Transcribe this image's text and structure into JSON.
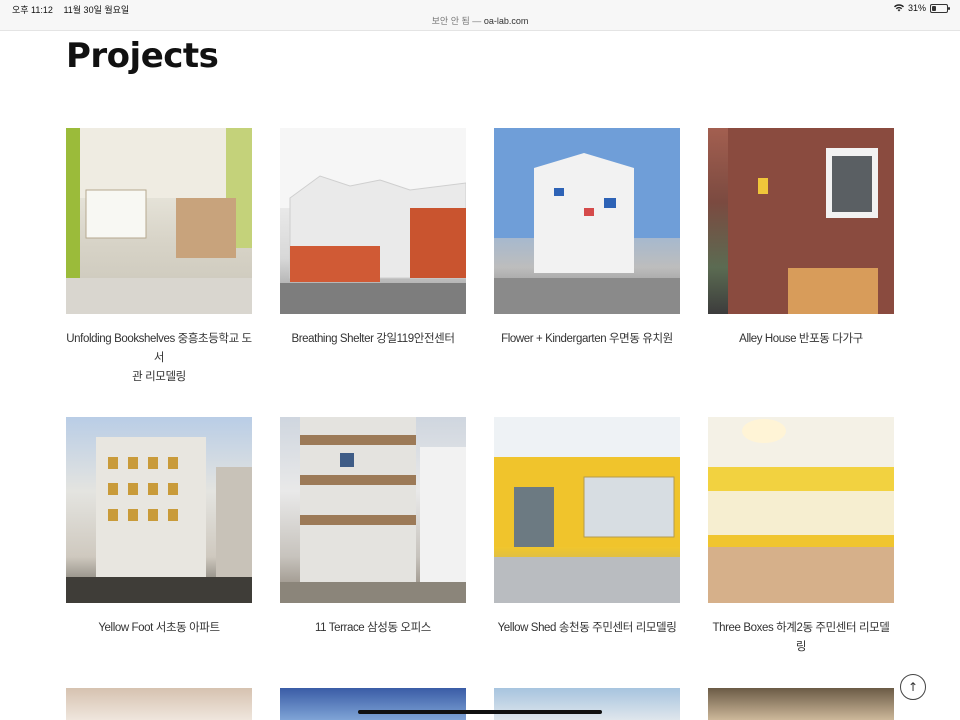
{
  "status": {
    "time": "오후 11:12",
    "date": "11월 30일 월요일",
    "battery": "31%",
    "battery_level": 0.31
  },
  "url": {
    "security": "보안 안 됨",
    "separator": "—",
    "host": "oa-lab.com"
  },
  "page": {
    "title": "Projects"
  },
  "projects": [
    {
      "line1": "Unfolding Bookshelves 중흥초등학교 도서",
      "line2": "관 리모델링"
    },
    {
      "line1": "Breathing Shelter 강일119안전센터",
      "line2": ""
    },
    {
      "line1": "Flower + Kindergarten 우면동 유치원",
      "line2": ""
    },
    {
      "line1": "Alley House 반포동 다가구",
      "line2": ""
    },
    {
      "line1": "Yellow Foot 서초동 아파트",
      "line2": ""
    },
    {
      "line1": "11 Terrace 삼성동 오피스",
      "line2": ""
    },
    {
      "line1": "Yellow Shed 송천동 주민센터 리모델링",
      "line2": ""
    },
    {
      "line1": "Three Boxes 하계2동 주민센터 리모델링",
      "line2": ""
    }
  ],
  "controls": {
    "back_to_top": "↑"
  },
  "icons": {
    "wifi": "wifi-icon",
    "battery": "battery-icon",
    "back_to_top": "arrow-up-icon"
  }
}
